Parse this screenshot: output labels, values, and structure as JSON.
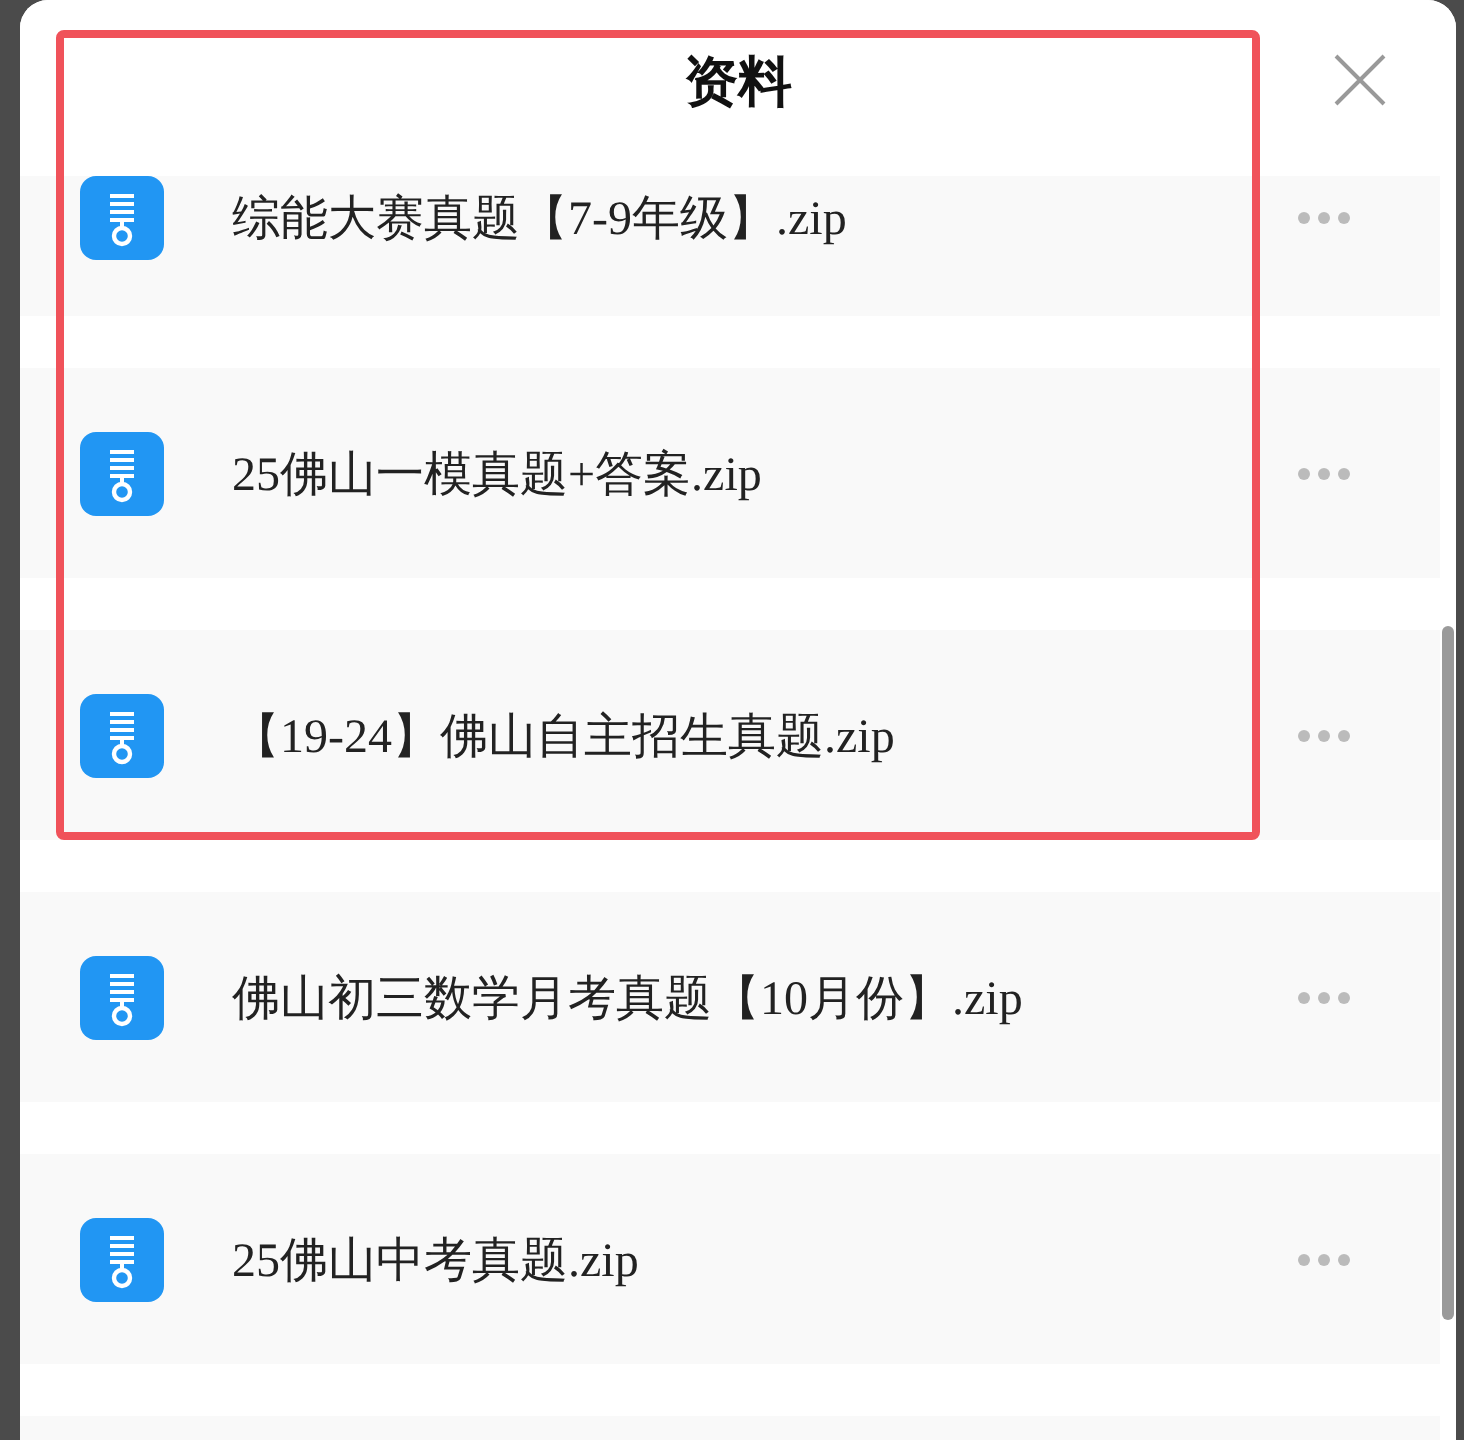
{
  "dialog": {
    "title": "资料"
  },
  "files": [
    {
      "name": "综能大赛真题【7-9年级】.zip"
    },
    {
      "name": "25佛山一模真题+答案.zip"
    },
    {
      "name": "【19-24】佛山自主招生真题.zip"
    },
    {
      "name": "佛山初三数学月考真题【10月份】.zip"
    },
    {
      "name": "25佛山中考真题.zip"
    }
  ]
}
